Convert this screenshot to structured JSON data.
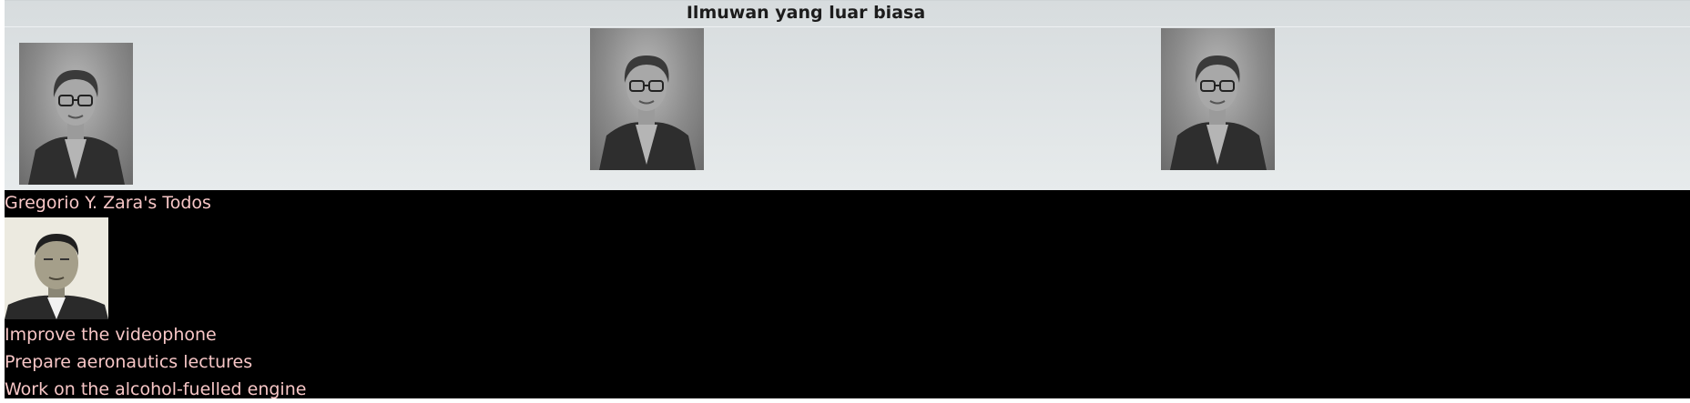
{
  "gallery": {
    "title": "Ilmuwan yang luar biasa",
    "photos": [
      {
        "icon": "scientist-portrait"
      },
      {
        "icon": "scientist-portrait"
      },
      {
        "icon": "scientist-portrait"
      }
    ]
  },
  "todos": {
    "title": "Gregorio Y. Zara's Todos",
    "avatar_icon": "scientist-portrait",
    "items": [
      "Improve the videophone",
      "Prepare aeronautics lectures",
      "Work on the alcohol-fuelled engine"
    ],
    "text_color": "#f7c6c6",
    "background": "#000000"
  }
}
